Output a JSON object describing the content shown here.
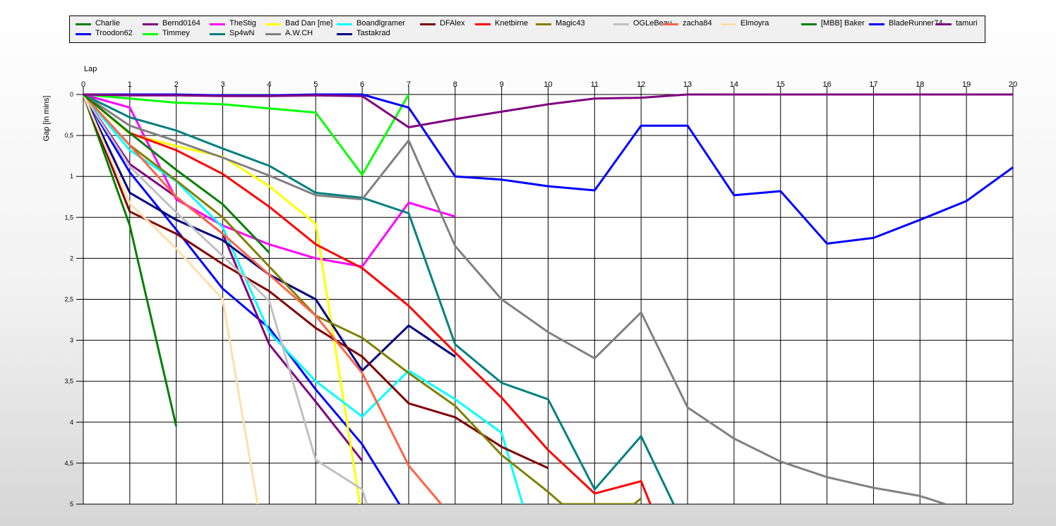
{
  "chart_data": {
    "type": "line",
    "xlabel": "Lap",
    "ylabel": "Gap [in mins]",
    "xlim": [
      0,
      20
    ],
    "ylim": [
      0,
      5
    ],
    "y_inverted": true,
    "grid": true,
    "legend_position": "top",
    "x_ticks": [
      "0",
      "1",
      "2",
      "3",
      "4",
      "5",
      "6",
      "7",
      "8",
      "9",
      "10",
      "11",
      "12",
      "13",
      "14",
      "15",
      "16",
      "17",
      "18",
      "19",
      "20"
    ],
    "y_ticks": [
      "0",
      "0,5",
      "1",
      "1,5",
      "2",
      "2,5",
      "3",
      "3,5",
      "4",
      "4,5",
      "5"
    ],
    "series": [
      {
        "name": "Charlie",
        "color": "#008000",
        "x": [
          0,
          1,
          2
        ],
        "y": [
          0,
          1.6,
          4.05
        ]
      },
      {
        "name": "Troodon62",
        "color": "#0000ff",
        "x": [
          0,
          1,
          2,
          3,
          4,
          5,
          6,
          6.8
        ],
        "y": [
          0,
          0.95,
          1.65,
          2.37,
          2.85,
          3.6,
          4.27,
          5.0
        ]
      },
      {
        "name": "Bernd0164",
        "color": "#800080",
        "x": [
          0,
          1,
          2,
          3,
          4,
          5,
          6
        ],
        "y": [
          0,
          0.85,
          1.25,
          1.7,
          3.05,
          3.75,
          4.47
        ]
      },
      {
        "name": "Timmey",
        "color": "#00ff00",
        "x": [
          0,
          1,
          2,
          3,
          4,
          5,
          6,
          7
        ],
        "y": [
          0,
          0.05,
          0.1,
          0.12,
          0.17,
          0.22,
          0.98,
          0
        ]
      },
      {
        "name": "TheStig",
        "color": "#ff00ff",
        "x": [
          0,
          1,
          2,
          3,
          4,
          5,
          6,
          7,
          8
        ],
        "y": [
          0,
          0.16,
          1.28,
          1.6,
          1.83,
          2.0,
          2.1,
          1.32,
          1.49
        ]
      },
      {
        "name": "Sp4wN",
        "color": "#008080",
        "x": [
          0,
          1,
          2,
          3,
          4,
          5,
          6,
          7,
          8,
          9,
          10,
          11,
          12,
          12.7
        ],
        "y": [
          0,
          0.28,
          0.44,
          0.66,
          0.87,
          1.2,
          1.26,
          1.45,
          3.05,
          3.52,
          3.72,
          4.82,
          4.17,
          5.0
        ]
      },
      {
        "name": "Bad Dan [me]",
        "color": "#ffff00",
        "x": [
          0,
          1,
          2,
          3,
          4,
          5,
          5.95
        ],
        "y": [
          0,
          0.48,
          0.63,
          0.76,
          1.12,
          1.58,
          5.0
        ]
      },
      {
        "name": "A.W.CH",
        "color": "#808080",
        "x": [
          0,
          1,
          2,
          3,
          4,
          5,
          6,
          7,
          8,
          9,
          10,
          11,
          12,
          13,
          14,
          15,
          16,
          17,
          18,
          18.55
        ],
        "y": [
          0,
          0.38,
          0.57,
          0.77,
          0.99,
          1.23,
          1.28,
          0.56,
          1.85,
          2.5,
          2.9,
          3.22,
          2.66,
          3.82,
          4.2,
          4.48,
          4.67,
          4.8,
          4.9,
          5.0
        ]
      },
      {
        "name": "Boandlgramer",
        "color": "#00ffff",
        "x": [
          0,
          1,
          2,
          3,
          4,
          5,
          6,
          7,
          8,
          9,
          9.45
        ],
        "y": [
          0,
          0.68,
          1.06,
          1.62,
          2.9,
          3.5,
          3.93,
          3.37,
          3.72,
          4.13,
          5.0
        ]
      },
      {
        "name": "Tastakrad",
        "color": "#000080",
        "x": [
          0,
          1,
          2,
          3,
          4,
          5,
          6,
          7,
          8
        ],
        "y": [
          0,
          1.2,
          1.53,
          1.78,
          2.2,
          2.5,
          3.37,
          2.82,
          3.2
        ]
      },
      {
        "name": "DFAlex",
        "color": "#800000",
        "x": [
          0,
          1,
          2,
          3,
          4,
          5,
          6,
          7,
          8,
          9,
          10
        ],
        "y": [
          0,
          1.43,
          1.7,
          2.07,
          2.4,
          2.85,
          3.2,
          3.77,
          3.94,
          4.3,
          4.56
        ]
      },
      {
        "name": "Knetbirne",
        "color": "#ff0000",
        "x": [
          0,
          1,
          2,
          3,
          4,
          5,
          6,
          7,
          8,
          9,
          10,
          11,
          12,
          12.2
        ],
        "y": [
          0,
          0.47,
          0.68,
          0.97,
          1.37,
          1.83,
          2.12,
          2.58,
          3.15,
          3.7,
          4.34,
          4.87,
          4.72,
          5.0
        ]
      },
      {
        "name": "Magic43",
        "color": "#808000",
        "x": [
          0,
          1,
          2,
          3,
          4,
          5,
          6,
          7,
          8,
          9,
          10,
          10.3,
          11.85,
          12
        ],
        "y": [
          0,
          0.62,
          1.05,
          1.5,
          2.1,
          2.7,
          2.97,
          3.4,
          3.8,
          4.4,
          4.85,
          5.0,
          5.0,
          4.93
        ]
      },
      {
        "name": "OGLeBeau",
        "color": "#c0c0c0",
        "x": [
          0,
          1,
          2,
          3,
          4,
          5,
          6,
          6.1
        ],
        "y": [
          0,
          0.88,
          1.44,
          1.97,
          2.52,
          4.46,
          4.82,
          5.0
        ]
      },
      {
        "name": "zacha84",
        "color": "#ff6347",
        "x": [
          0,
          1,
          2,
          3,
          4,
          5,
          6,
          7,
          7.7
        ],
        "y": [
          0,
          0.62,
          1.25,
          1.7,
          2.2,
          2.7,
          3.4,
          4.53,
          5.0
        ]
      },
      {
        "name": "Elmoyra",
        "color": "#ffdead",
        "x": [
          0,
          1,
          2,
          3,
          3.75
        ],
        "y": [
          0,
          1.33,
          1.88,
          2.5,
          5.0
        ]
      },
      {
        "name": "[MBB] Baker",
        "color": "#008000",
        "x": [
          0,
          1,
          2,
          3,
          4
        ],
        "y": [
          0,
          0.47,
          0.92,
          1.34,
          1.93
        ]
      },
      {
        "name": "BladeRunner74",
        "color": "#0000ff",
        "x": [
          0,
          1,
          2,
          3,
          4,
          5,
          6,
          7,
          8,
          9,
          10,
          11,
          12,
          13,
          14,
          15,
          16,
          17,
          18,
          19,
          20
        ],
        "y": [
          0,
          0,
          0,
          0.01,
          0.01,
          0,
          0,
          0.16,
          1.0,
          1.04,
          1.12,
          1.17,
          0.38,
          0.38,
          1.23,
          1.18,
          1.82,
          1.75,
          1.53,
          1.3,
          0.89
        ]
      },
      {
        "name": "tamuri",
        "color": "#800080",
        "x": [
          0,
          1,
          2,
          3,
          4,
          5,
          6,
          7,
          8,
          9,
          10,
          11,
          12,
          13,
          14,
          15,
          16,
          17,
          18,
          19,
          20
        ],
        "y": [
          0,
          0.01,
          0.01,
          0.02,
          0.02,
          0.01,
          0.02,
          0.4,
          0.3,
          0.21,
          0.12,
          0.05,
          0.04,
          0,
          0,
          0,
          0,
          0,
          0,
          0,
          0
        ]
      }
    ]
  }
}
